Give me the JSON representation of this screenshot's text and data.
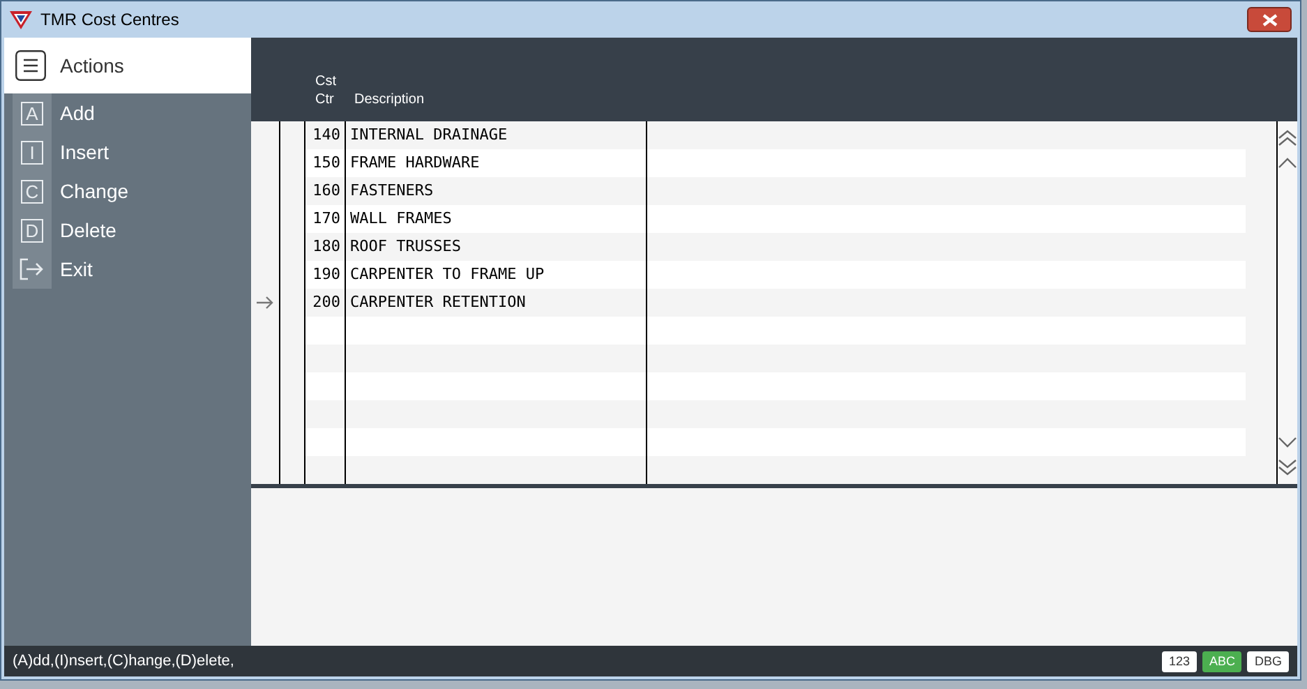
{
  "window": {
    "title": "TMR Cost Centres"
  },
  "sidebar": {
    "title": "Actions",
    "items": [
      {
        "kind": "key",
        "key": "A",
        "label": "Add"
      },
      {
        "kind": "key",
        "key": "I",
        "label": "Insert"
      },
      {
        "kind": "key",
        "key": "C",
        "label": "Change"
      },
      {
        "kind": "key",
        "key": "D",
        "label": "Delete"
      },
      {
        "kind": "exit",
        "label": "Exit"
      }
    ]
  },
  "table": {
    "columns": [
      {
        "label_lines": [
          "Cst",
          "Ctr"
        ]
      },
      {
        "label_lines": [
          "Description"
        ]
      }
    ],
    "rows": [
      {
        "cells": [
          "140",
          "INTERNAL DRAINAGE"
        ],
        "current": false
      },
      {
        "cells": [
          "150",
          "FRAME HARDWARE"
        ],
        "current": false
      },
      {
        "cells": [
          "160",
          "FASTENERS"
        ],
        "current": false
      },
      {
        "cells": [
          "170",
          "WALL FRAMES"
        ],
        "current": false
      },
      {
        "cells": [
          "180",
          "ROOF TRUSSES"
        ],
        "current": false
      },
      {
        "cells": [
          "190",
          "CARPENTER TO FRAME UP"
        ],
        "current": false
      },
      {
        "cells": [
          "200",
          "CARPENTER RETENTION"
        ],
        "current": true
      }
    ]
  },
  "status_bar": {
    "text": "(A)dd,(I)nsert,(C)hange,(D)elete,",
    "badges": [
      {
        "label": "123",
        "selected": false
      },
      {
        "label": "ABC",
        "selected": true
      },
      {
        "label": "DBG",
        "selected": false
      }
    ]
  }
}
